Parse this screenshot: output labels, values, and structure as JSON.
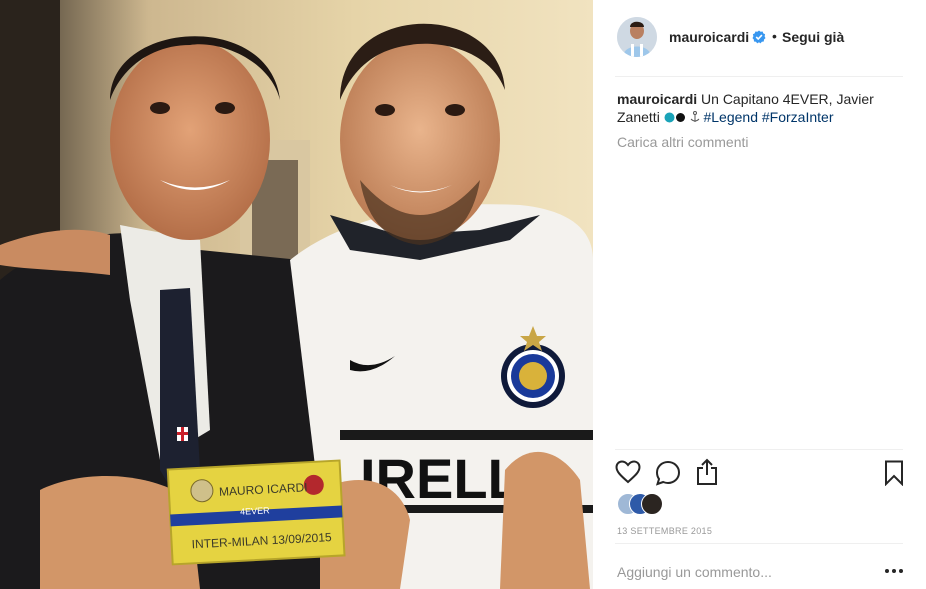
{
  "post": {
    "username": "mauroicardi",
    "separator": "•",
    "follow_label": "Segui già",
    "caption_user": "mauroicardi",
    "caption_text_1": "Un Capitano 4EVER, Javier",
    "caption_text_2": "Zanetti",
    "hashtag_1": "#Legend",
    "hashtag_2": "#ForzaInter",
    "load_more": "Carica altri commenti",
    "date": "13 SETTEMBRE 2015",
    "comment_placeholder": "Aggiungi un commento..."
  },
  "photo": {
    "armband_line_1": "MAURO ICARDI",
    "armband_line_2": "4EVER",
    "armband_line_3": "INTER-MILAN 13/09/2015",
    "shirt_sponsor": "IRELLI"
  },
  "icons": {
    "heart": "heart-icon",
    "comment": "comment-icon",
    "share": "share-icon",
    "save": "bookmark-icon",
    "verified": "verified-badge-icon",
    "options": "more-options-icon"
  },
  "colors": {
    "verified_blue": "#3897f0",
    "hashtag": "#003569",
    "muted": "#999999",
    "text": "#262626"
  }
}
